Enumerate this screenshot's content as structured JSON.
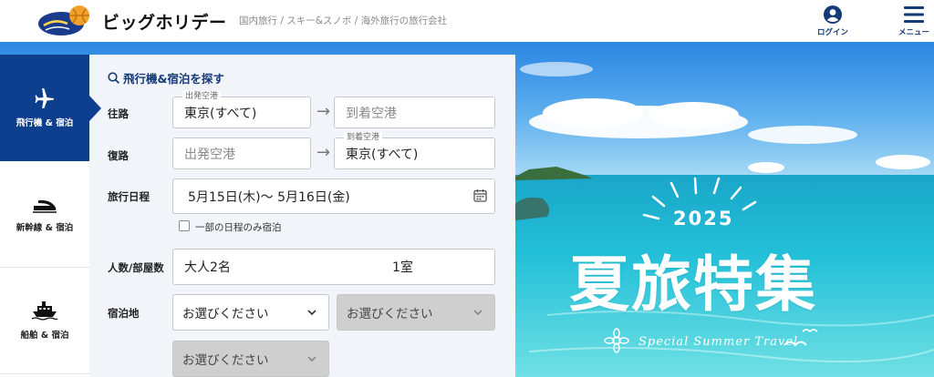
{
  "header": {
    "logo_text": "ビッグホリデー",
    "tagline": "国内旅行 / スキー&スノボ / 海外旅行の旅行会社",
    "login_label": "ログイン",
    "menu_label": "メニュー"
  },
  "tabs": [
    {
      "label": "飛行機 & 宿泊",
      "icon": "airplane-icon",
      "active": true
    },
    {
      "label": "新幹線 & 宿泊",
      "icon": "bullet-train-icon",
      "active": false
    },
    {
      "label": "船舶 & 宿泊",
      "icon": "ship-icon",
      "active": false
    }
  ],
  "search": {
    "heading": "飛行機&宿泊を探す",
    "outbound_label": "往路",
    "return_label": "復路",
    "outbound_departure_float": "出発空港",
    "outbound_departure_value": "東京(すべて)",
    "outbound_arrival_placeholder": "到着空港",
    "return_departure_placeholder": "出発空港",
    "return_arrival_float": "到着空港",
    "return_arrival_value": "東京(すべて)",
    "dates_label": "旅行日程",
    "dates_value": "5月15日(木)～ 5月16日(金)",
    "partial_stay_label": "一部の日程のみ宿泊",
    "guests_label": "人数/部屋数",
    "guests_value": "大人2名",
    "rooms_value": "1室",
    "destination_label": "宿泊地",
    "select_placeholder_1": "お選びください",
    "select_placeholder_2": "お選びください",
    "select_placeholder_3": "お選びください"
  },
  "hero": {
    "year": "2025",
    "title": "夏旅特集",
    "subtitle": "Special Summer Travel"
  },
  "colors": {
    "brand_navy": "#0e3f8f",
    "panel_bg": "#f1f4f8",
    "sea": "#1fb5d6"
  }
}
